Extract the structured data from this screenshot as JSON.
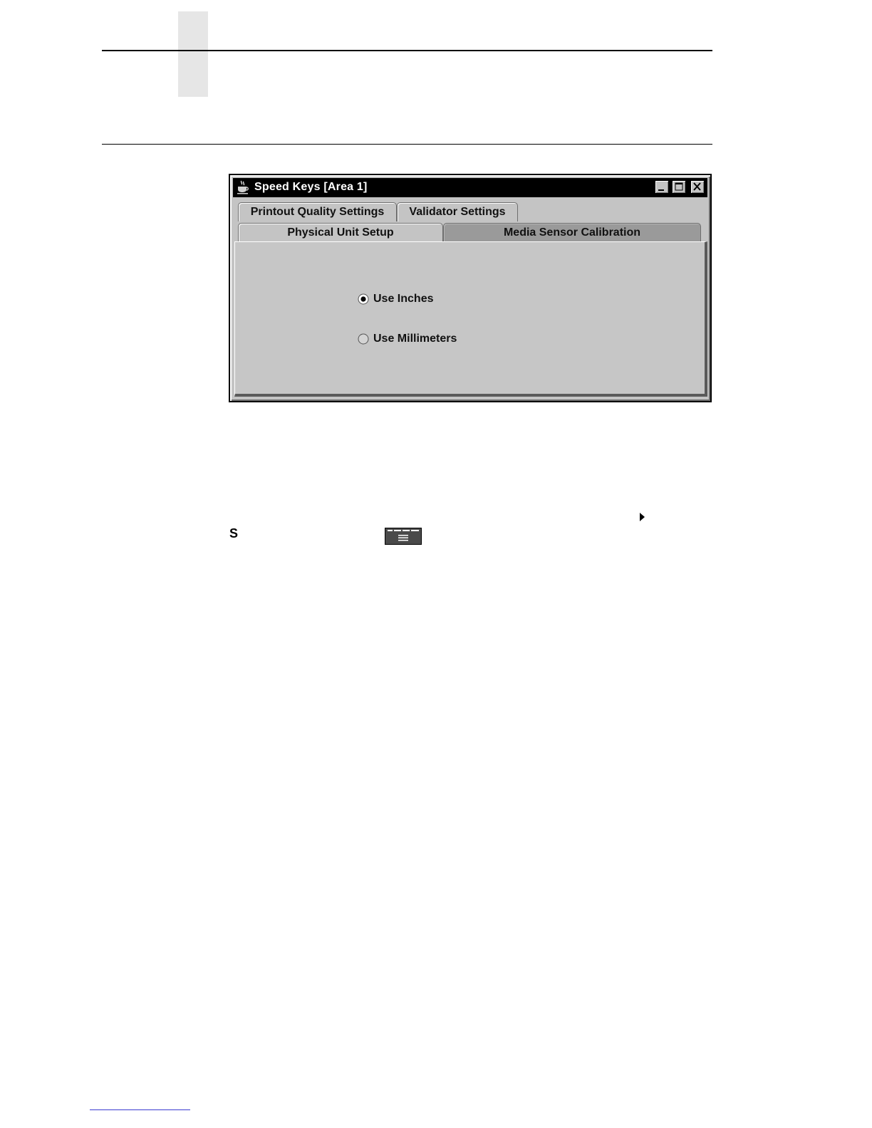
{
  "window": {
    "title": "Speed Keys [Area 1]"
  },
  "tabs": {
    "row_top": [
      {
        "label": "Printout Quality Settings"
      },
      {
        "label": "Validator Settings"
      }
    ],
    "row_bottom": [
      {
        "label": "Physical Unit Setup"
      },
      {
        "label": "Media Sensor Calibration",
        "selected": true
      }
    ]
  },
  "units": {
    "options": [
      {
        "label": "Use Inches",
        "checked": true
      },
      {
        "label": "Use Millimeters",
        "checked": false
      }
    ]
  },
  "body": {
    "s_text": "S"
  },
  "icons": {
    "window_icon": "java-coffee-cup-icon",
    "minimize": "minimize-icon",
    "maximize": "maximize-icon",
    "close": "close-icon",
    "arrow": "right-arrow-icon",
    "menu_key": "menu-key-icon"
  }
}
